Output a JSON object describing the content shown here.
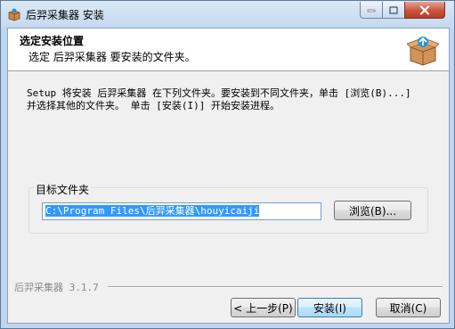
{
  "window": {
    "title": "后羿采集器 安装"
  },
  "header": {
    "title": "选定安装位置",
    "subtitle": "选定 后羿采集器 要安装的文件夹。",
    "icon": "installer-box-icon"
  },
  "body": {
    "description_line1": "Setup 将安装 后羿采集器 在下列文件夹。要安装到不同文件夹，单击 [浏览(B)...]",
    "description_line2": "并选择其他的文件夹。 单击 [安装(I)] 开始安装进程。"
  },
  "destination": {
    "label": "目标文件夹",
    "path": "C:\\Program Files\\后羿采集器\\houyicaiji",
    "browse_label": "浏览(B)..."
  },
  "footer": {
    "brand": "后羿采集器 3.1.7",
    "back_label": "< 上一步(P)",
    "install_label": "安装(I)",
    "cancel_label": "取消(C)"
  }
}
